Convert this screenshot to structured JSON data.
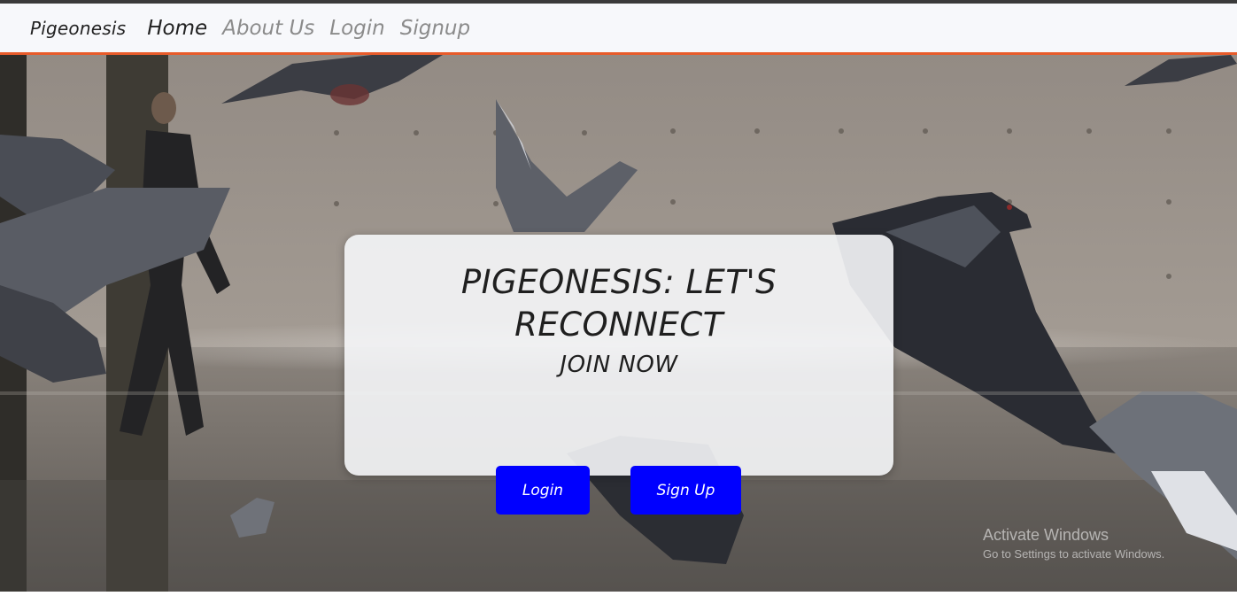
{
  "navbar": {
    "brand": "Pigeonesis",
    "links": [
      {
        "label": "Home",
        "active": true
      },
      {
        "label": "About Us",
        "active": false
      },
      {
        "label": "Login",
        "active": false
      },
      {
        "label": "Signup",
        "active": false
      }
    ],
    "accent_color": "#e85b2a"
  },
  "hero": {
    "title": "PIGEONESIS: LET'S RECONNECT",
    "subtitle": "JOIN NOW",
    "buttons": {
      "login_label": "Login",
      "signup_label": "Sign Up",
      "color": "#0000ff"
    }
  },
  "watermark": {
    "title": "Activate Windows",
    "subtitle": "Go to Settings to activate Windows."
  }
}
